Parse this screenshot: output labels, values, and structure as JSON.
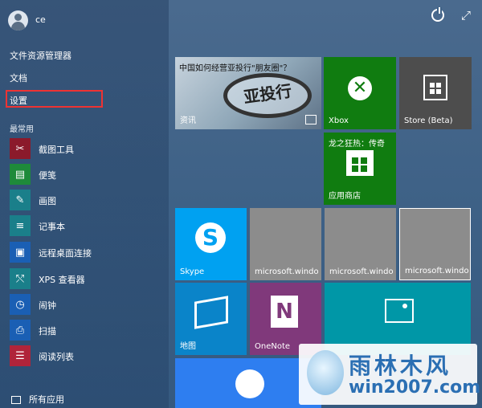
{
  "user": {
    "name": "ce"
  },
  "places": [
    "文件资源管理器",
    "文档",
    "设置"
  ],
  "most_used_label": "最常用",
  "apps": [
    {
      "label": "截图工具",
      "icon": "scissors-icon",
      "color": "#8b1a2b",
      "glyph": "✂"
    },
    {
      "label": "便笺",
      "icon": "sticky-notes-icon",
      "color": "#1e8a3a",
      "glyph": "▤"
    },
    {
      "label": "画图",
      "icon": "paint-icon",
      "color": "#1a7f8a",
      "glyph": "🎨"
    },
    {
      "label": "记事本",
      "icon": "notepad-icon",
      "color": "#1a7f8a",
      "glyph": "≡"
    },
    {
      "label": "远程桌面连接",
      "icon": "remote-desktop-icon",
      "color": "#1a5fb4",
      "glyph": "▣"
    },
    {
      "label": "XPS 查看器",
      "icon": "xps-viewer-icon",
      "color": "#1a7f8a",
      "glyph": "⤲"
    },
    {
      "label": "闹钟",
      "icon": "alarm-icon",
      "color": "#1a5fb4",
      "glyph": "◷"
    },
    {
      "label": "扫描",
      "icon": "scan-icon",
      "color": "#1a5fb4",
      "glyph": "⎙"
    },
    {
      "label": "阅读列表",
      "icon": "reading-list-icon",
      "color": "#b0243a",
      "glyph": "☰"
    }
  ],
  "all_apps_label": "所有应用",
  "tiles": {
    "news": {
      "headline": "中国如何经营亚投行\"朋友圈\"？",
      "label": "资讯",
      "banner": "亚投行"
    },
    "xbox": {
      "label": "Xbox"
    },
    "store_beta": {
      "label": "Store (Beta)"
    },
    "store": {
      "label": "应用商店",
      "game": "龙之狂热：传奇"
    },
    "skype": {
      "label": "Skype"
    },
    "ms1": {
      "label": "microsoft.windo"
    },
    "ms2": {
      "label": "microsoft.windo"
    },
    "ms3": {
      "label": "microsoft.windo"
    },
    "maps": {
      "label": "地图"
    },
    "onenote": {
      "label": "OneNote"
    }
  },
  "watermark": {
    "title": "雨林木风",
    "url": "win2007.com"
  },
  "colors": {
    "xbox": "#107c10",
    "store_beta": "#4d4d4d",
    "store": "#107c10",
    "skype": "#00a1f1",
    "gray": "#8c8c8c",
    "maps": "#0a84c9",
    "onenote": "#80397b",
    "teal": "#0097a7",
    "weather": "#2e7ef0"
  }
}
